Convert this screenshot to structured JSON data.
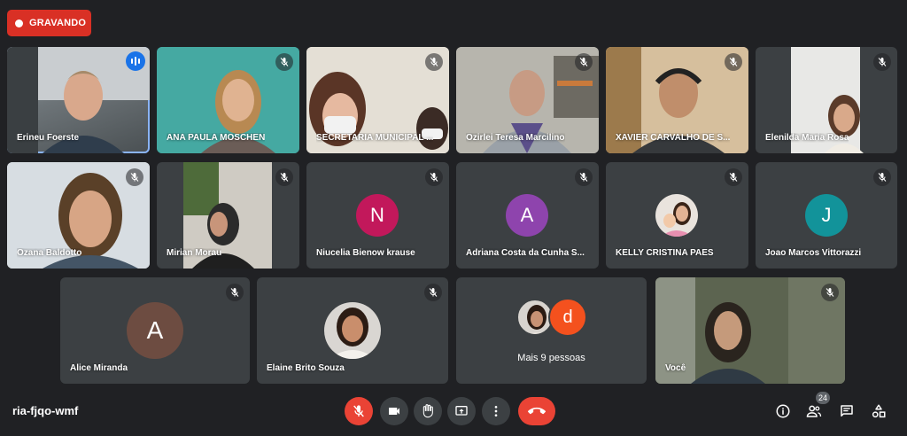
{
  "recording": {
    "label": "GRAVANDO",
    "color": "#d93025"
  },
  "participants": [
    {
      "name": "Erineu Foerste",
      "speaking": true,
      "video": true
    },
    {
      "name": "ANA PAULA MOSCHEN",
      "muted": true,
      "video": true
    },
    {
      "name": "SECRETARIA MUNICIPAL ...",
      "muted": true,
      "video": true
    },
    {
      "name": "Ozirlei Teresa Marcilino",
      "muted": true,
      "video": true
    },
    {
      "name": "XAVIER CARVALHO DE S...",
      "muted": true,
      "video": true
    },
    {
      "name": "Elenilda Maria Rosa",
      "muted": true,
      "video": true
    },
    {
      "name": "Ozana Baldotto",
      "muted": true,
      "video": true
    },
    {
      "name": "Mirian Morau",
      "muted": true,
      "video": true
    },
    {
      "name": "Niucelia Bienow krause",
      "muted": true,
      "initial": "N",
      "avatar_color": "#c2185b"
    },
    {
      "name": "Adriana Costa da Cunha S...",
      "muted": true,
      "initial": "A",
      "avatar_color": "#8e44ad"
    },
    {
      "name": "KELLY CRISTINA PAES",
      "muted": true,
      "avatar": "photo"
    },
    {
      "name": "Joao Marcos Vittorazzi",
      "muted": true,
      "initial": "J",
      "avatar_color": "#12939a"
    },
    {
      "name": "Alice Miranda",
      "muted": true,
      "initial": "A",
      "avatar_color": "#6d4c41"
    },
    {
      "name": "Elaine Brito Souza",
      "muted": true,
      "avatar": "photo"
    },
    {
      "name": "Você",
      "muted": true,
      "video": true
    }
  ],
  "more_people": {
    "label": "Mais 9 pessoas",
    "initial": "d",
    "avatar_color": "#f4511e"
  },
  "meeting_code": "ria-fjqo-wmf",
  "controls": {
    "mic": "mic-off-icon",
    "camera": "camera-icon",
    "raise_hand": "hand-icon",
    "present": "present-icon",
    "more": "more-vert-icon",
    "end_call": "call-end-icon"
  },
  "people_count": "24",
  "colors": {
    "background": "#202124",
    "tile": "#3c4043",
    "danger": "#ea4335",
    "accent": "#1a73e8"
  }
}
